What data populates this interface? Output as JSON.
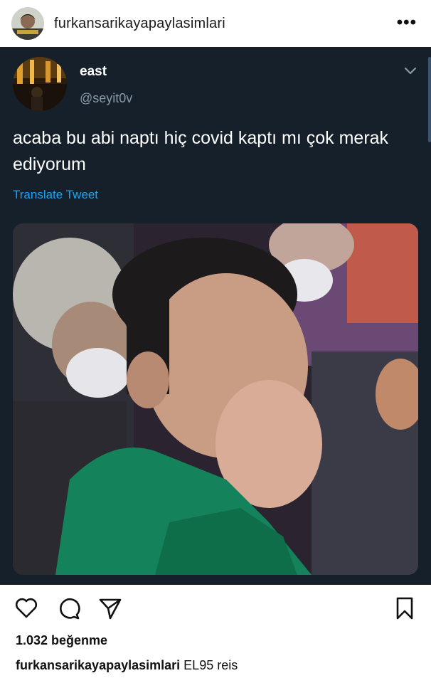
{
  "post": {
    "username": "furkansarikayapaylasimlari",
    "more_label": "•••"
  },
  "tweet": {
    "display_name": "east",
    "handle": "@seyit0v",
    "text": "acaba bu abi naptı hiç covid kaptı mı çok merak ediyorum",
    "translate_label": "Translate Tweet"
  },
  "footer": {
    "likes": "1.032 beğenme",
    "caption_user": "furkansarikayapaylasimlari",
    "caption_text": "EL95 reis"
  },
  "icons": {
    "like": "heart-icon",
    "comment": "comment-icon",
    "share": "send-icon",
    "save": "bookmark-icon",
    "tweet_menu": "chevron-down-icon"
  },
  "colors": {
    "tweet_bg": "#15202b",
    "link_blue": "#1da1f2",
    "handle_gray": "#8899a6"
  }
}
